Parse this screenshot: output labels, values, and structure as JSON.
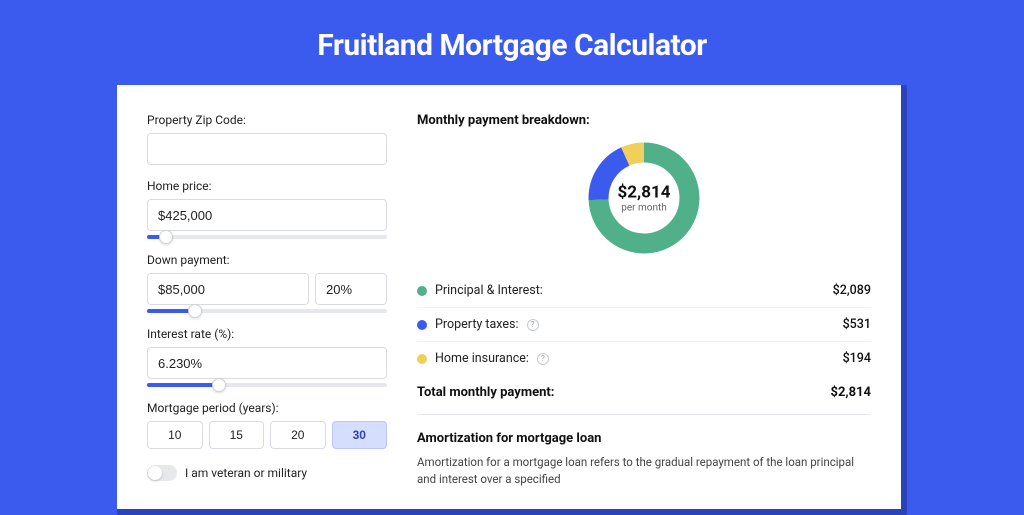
{
  "title": "Fruitland Mortgage Calculator",
  "form": {
    "zip_label": "Property Zip Code:",
    "zip_value": "",
    "price_label": "Home price:",
    "price_value": "$425,000",
    "price_slider_pct": 8,
    "down_label": "Down payment:",
    "down_value": "$85,000",
    "down_pct_value": "20%",
    "down_slider_pct": 20,
    "rate_label": "Interest rate (%):",
    "rate_value": "6.230%",
    "rate_slider_pct": 30,
    "period_label": "Mortgage period (years):",
    "periods": [
      "10",
      "15",
      "20",
      "30"
    ],
    "period_selected": "30",
    "veteran_label": "I am veteran or military",
    "veteran_on": false
  },
  "breakdown": {
    "title": "Monthly payment breakdown:",
    "total_amount": "$2,814",
    "total_sub": "per month",
    "items": [
      {
        "label": "Principal & Interest:",
        "value": "$2,089",
        "color": "#4fb08a",
        "info": false
      },
      {
        "label": "Property taxes:",
        "value": "$531",
        "color": "#3b5bef",
        "info": true
      },
      {
        "label": "Home insurance:",
        "value": "$194",
        "color": "#f0cf5b",
        "info": true
      }
    ],
    "total_label": "Total monthly payment:",
    "total_value": "$2,814"
  },
  "amort": {
    "title": "Amortization for mortgage loan",
    "body": "Amortization for a mortgage loan refers to the gradual repayment of the loan principal and interest over a specified"
  },
  "chart_data": {
    "type": "pie",
    "title": "Monthly payment breakdown",
    "series": [
      {
        "name": "Principal & Interest",
        "value": 2089,
        "color": "#4fb08a"
      },
      {
        "name": "Property taxes",
        "value": 531,
        "color": "#3b5bef"
      },
      {
        "name": "Home insurance",
        "value": 194,
        "color": "#f0cf5b"
      }
    ],
    "total": 2814,
    "center_label": "$2,814",
    "center_sub": "per month"
  }
}
